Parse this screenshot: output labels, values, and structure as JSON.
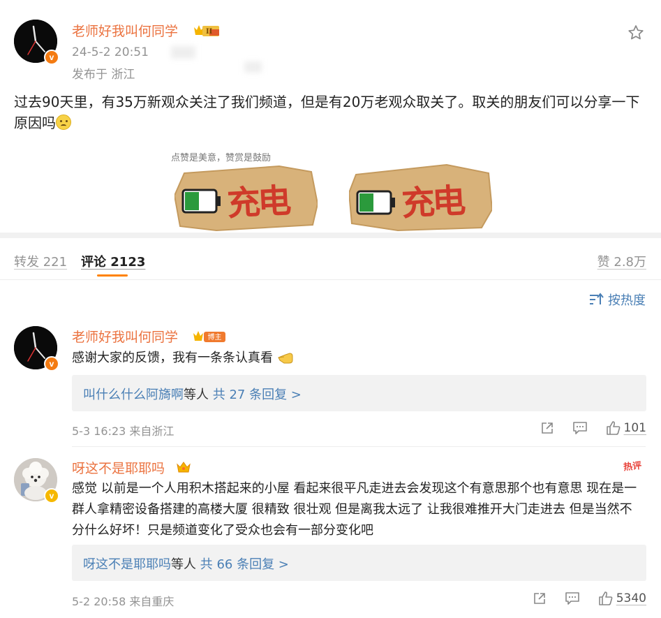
{
  "post": {
    "author": "老师好我叫何同学",
    "level_badge": "II",
    "time": "24-5-2 20:51",
    "location": "发布于 浙江",
    "text": "过去90天里，有35万新观众关注了我们频道，但是有20万老观众取关了。取关的朋友们可以分享一下原因吗",
    "reward_note": "点赞是美意，赞赏是鼓励",
    "reward_buttons": [
      "充电",
      "充电"
    ],
    "icons": {
      "favorite": "star-icon",
      "verified": "v-badge-icon"
    }
  },
  "tabs": {
    "repost": "转发 221",
    "comments": "评论 2123",
    "likes": "赞 2.8万"
  },
  "sort": {
    "label": "按热度",
    "icon": "sort-icon"
  },
  "comments": [
    {
      "author": "老师好我叫何同学",
      "badge": "博主",
      "text": "感谢大家的反馈，我有一条条认真看",
      "reply_users": "叫什么什么阿旖啊",
      "reply_mid": "等人",
      "reply_count": "共 27 条回复 >",
      "meta": "5-3 16:23 来自浙江",
      "likes": "101"
    },
    {
      "author": "呀这不是耶耶吗",
      "hot_badge": "热评",
      "text": "感觉 以前是一个人用积木搭起来的小屋 看起来很平凡走进去会发现这个有意思那个也有意思 现在是一群人拿精密设备搭建的高楼大厦 很精致 很壮观 但是离我太远了 让我很难推开大门走进去 但是当然不分什么好坏！只是频道变化了受众也会有一部分变化吧",
      "reply_users": "呀这不是耶耶吗",
      "reply_mid": "等人",
      "reply_count": "共 66 条回复 >",
      "meta": "5-2 20:58 来自重庆",
      "likes": "5340"
    }
  ],
  "colors": {
    "username": "#eb7340",
    "link": "#4a7fb5",
    "tab_indicator": "#ff8200",
    "meta": "#939393",
    "hot": "#e8433b"
  }
}
